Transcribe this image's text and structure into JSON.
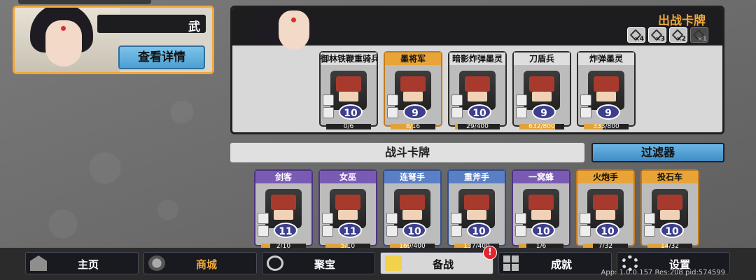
{
  "profile": {
    "name": "武",
    "detail_button": "查看详情"
  },
  "deck": {
    "title": "出战卡牌",
    "modifiers": [
      {
        "label": "×4",
        "active": true
      },
      {
        "label": "×3",
        "active": true
      },
      {
        "label": "×2",
        "active": true
      },
      {
        "label": "×1",
        "active": false
      }
    ],
    "cards": [
      {
        "name": "御林铁鞭重骑兵",
        "level": "10",
        "progress": "0/6",
        "fraction": 0.0,
        "rarity": "white"
      },
      {
        "name": "墨将军",
        "level": "9",
        "progress": "8/16",
        "fraction": 0.5,
        "rarity": "gold"
      },
      {
        "name": "暗影炸弹墨灵",
        "level": "10",
        "progress": "29/400",
        "fraction": 0.07,
        "rarity": "white"
      },
      {
        "name": "刀盾兵",
        "level": "9",
        "progress": "632/800",
        "fraction": 0.79,
        "rarity": "white"
      },
      {
        "name": "炸弹墨灵",
        "level": "9",
        "progress": "333/800",
        "fraction": 0.42,
        "rarity": "white"
      }
    ]
  },
  "combat": {
    "title": "战斗卡牌",
    "filter_button": "过滤器",
    "cards": [
      {
        "name": "剑客",
        "level": "11",
        "progress": "2/10",
        "fraction": 0.2,
        "rarity": "purple"
      },
      {
        "name": "女巫",
        "level": "11",
        "progress": "5/10",
        "fraction": 0.5,
        "rarity": "purple"
      },
      {
        "name": "连弩手",
        "level": "10",
        "progress": "169/400",
        "fraction": 0.42,
        "rarity": "blue"
      },
      {
        "name": "重斧手",
        "level": "10",
        "progress": "137/400",
        "fraction": 0.34,
        "rarity": "blue"
      },
      {
        "name": "一窝蜂",
        "level": "10",
        "progress": "1/6",
        "fraction": 0.17,
        "rarity": "purple"
      },
      {
        "name": "火炮手",
        "level": "10",
        "progress": "7/32",
        "fraction": 0.22,
        "rarity": "gold"
      },
      {
        "name": "投石车",
        "level": "10",
        "progress": "14/32",
        "fraction": 0.44,
        "rarity": "gold"
      }
    ]
  },
  "nav": {
    "home": "主页",
    "shop": "商城",
    "treasure": "聚宝",
    "prepare": "备战",
    "achievements": "成就",
    "settings": "设置",
    "badge": "!"
  },
  "build_info": "App: 1.0.0.157 Res:208 pid:574599"
}
